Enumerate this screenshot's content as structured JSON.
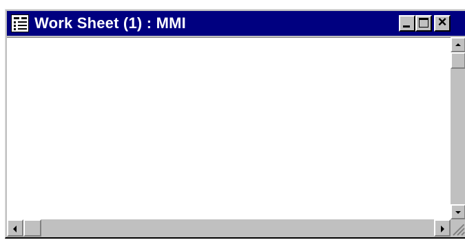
{
  "window": {
    "title": "Work Sheet (1) : MMI",
    "icon": "worksheet-icon",
    "title_bar_color": "#000080",
    "controls": {
      "minimize_icon": "minimize-icon",
      "maximize_icon": "maximize-icon",
      "close_icon": "close-icon",
      "close_label": "×"
    }
  },
  "scrollbars": {
    "vertical": {
      "up_icon": "arrow-up-icon",
      "down_icon": "arrow-down-icon"
    },
    "horizontal": {
      "left_icon": "arrow-left-icon",
      "right_icon": "arrow-right-icon"
    }
  },
  "colors": {
    "face": "#c0c0c0",
    "client": "#ffffff",
    "highlight": "#ffffff",
    "shadow": "#808080"
  }
}
